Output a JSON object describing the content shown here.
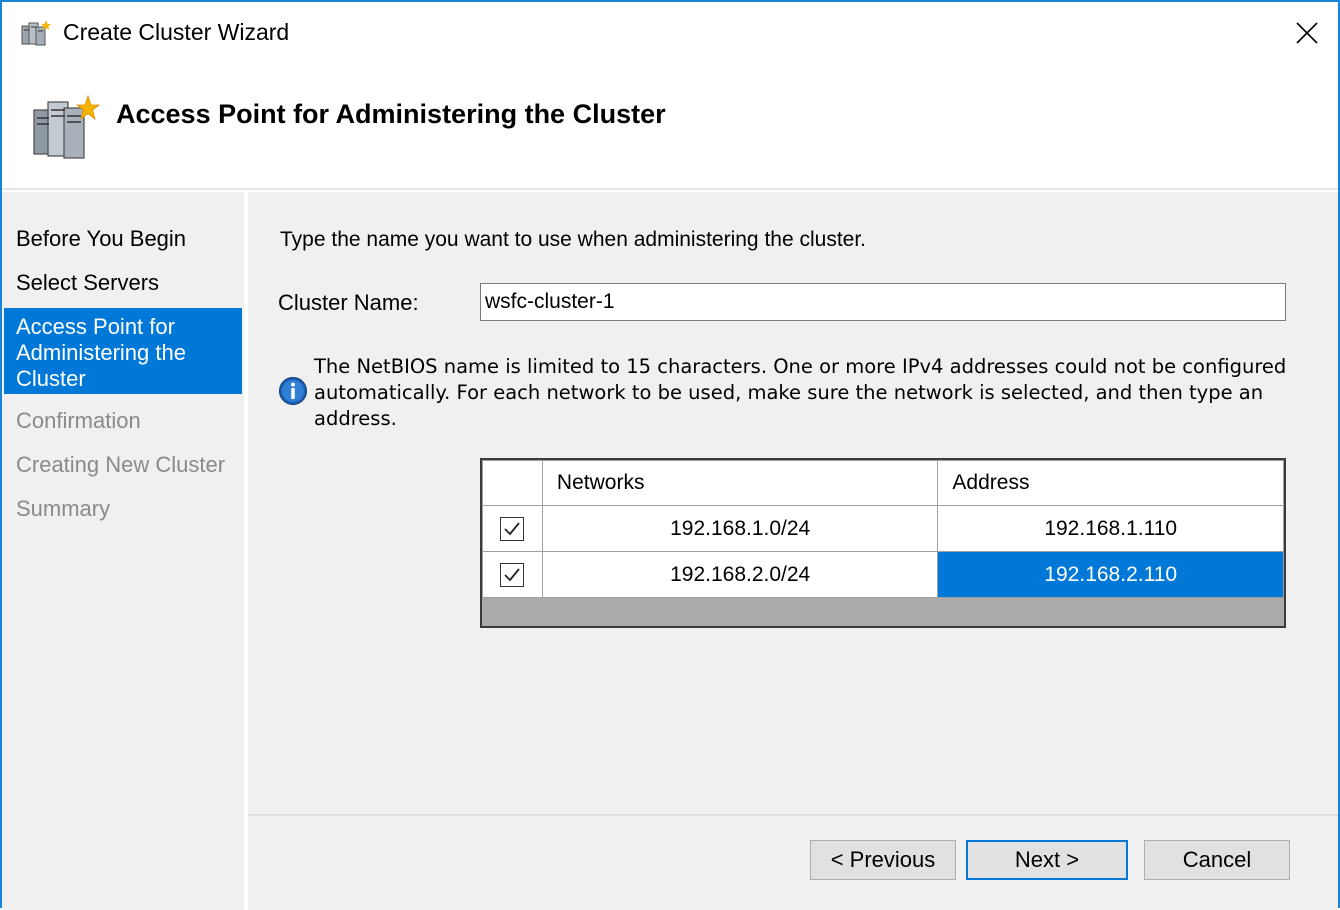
{
  "window": {
    "title": "Create Cluster Wizard",
    "header_title": "Access Point for Administering the Cluster"
  },
  "sidebar": {
    "items": [
      {
        "label": "Before You Begin",
        "state": "normal"
      },
      {
        "label": "Select Servers",
        "state": "normal"
      },
      {
        "label": "Access Point for Administering the Cluster",
        "state": "selected"
      },
      {
        "label": "Confirmation",
        "state": "disabled"
      },
      {
        "label": "Creating New Cluster",
        "state": "disabled"
      },
      {
        "label": "Summary",
        "state": "disabled"
      }
    ]
  },
  "main": {
    "instruction": "Type the name you want to use when administering the cluster.",
    "cluster_name_label": "Cluster Name:",
    "cluster_name_value": "wsfc-cluster-1",
    "info_message": "The NetBIOS name is limited to 15 characters.  One or more IPv4 addresses could not be configured automatically.  For each network to be used, make sure the network is selected, and then type an address.",
    "grid": {
      "headers": [
        "",
        "Networks",
        "Address"
      ],
      "rows": [
        {
          "checked": true,
          "network": "192.168.1.0/24",
          "address": "192.168.1.110",
          "selected": false
        },
        {
          "checked": true,
          "network": "192.168.2.0/24",
          "address": "192.168.2.110",
          "selected": true
        }
      ]
    }
  },
  "footer": {
    "previous_label": "< Previous",
    "next_label": "Next >",
    "cancel_label": "Cancel"
  },
  "colors": {
    "accent": "#0078d7",
    "window_border": "#1883d7",
    "panel_background": "#f0f0f0"
  },
  "icons": {
    "title": "cluster-wizard-icon",
    "header": "cluster-servers-icon",
    "info": "info-icon",
    "close": "close-icon"
  }
}
